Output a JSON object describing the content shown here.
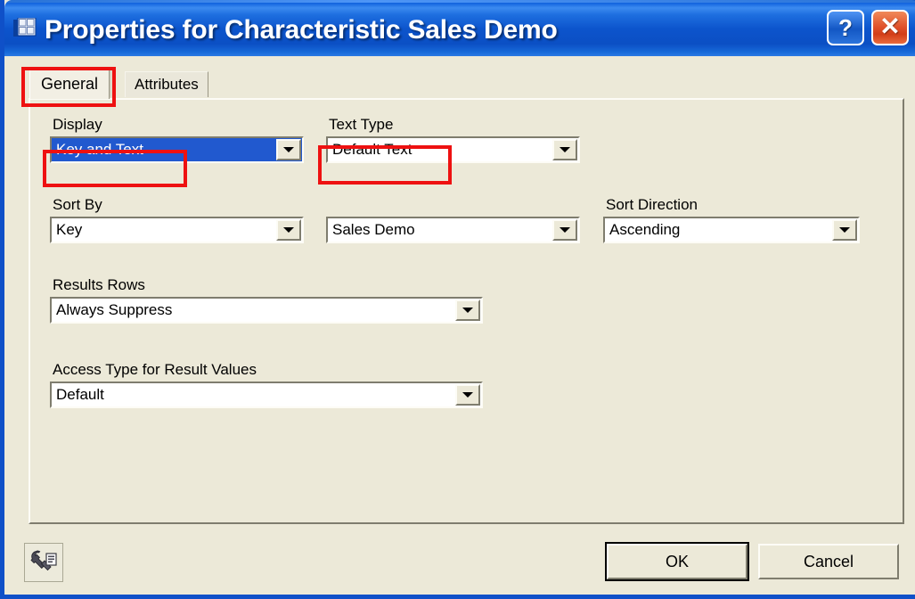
{
  "window": {
    "title": "Properties for Characteristic Sales Demo",
    "icon": "grid-table-icon",
    "help_label": "?",
    "close_label": "✕"
  },
  "tabs": [
    {
      "label": "General",
      "selected": true
    },
    {
      "label": "Attributes",
      "selected": false
    }
  ],
  "form": {
    "display": {
      "label": "Display",
      "value": "Key and Text",
      "focused": true
    },
    "text_type": {
      "label": "Text Type",
      "value": "Default Text"
    },
    "sort_by": {
      "label": "Sort By",
      "value": "Key",
      "secondary_value": "Sales Demo"
    },
    "sort_direction": {
      "label": "Sort Direction",
      "value": "Ascending"
    },
    "results_rows": {
      "label": "Results Rows",
      "value": "Always Suppress"
    },
    "access_type": {
      "label": "Access Type for Result Values",
      "value": "Default"
    }
  },
  "footer": {
    "tools_icon": "wrench-settings-icon",
    "ok_label": "OK",
    "cancel_label": "Cancel"
  },
  "annotations": {
    "colors": {
      "highlight": "#ee1111",
      "titlebar": "#0b55c8",
      "accent": "#2159cf"
    },
    "boxes": [
      {
        "target": "tab-general"
      },
      {
        "target": "display-combobox"
      },
      {
        "target": "text-type-combobox"
      }
    ]
  }
}
